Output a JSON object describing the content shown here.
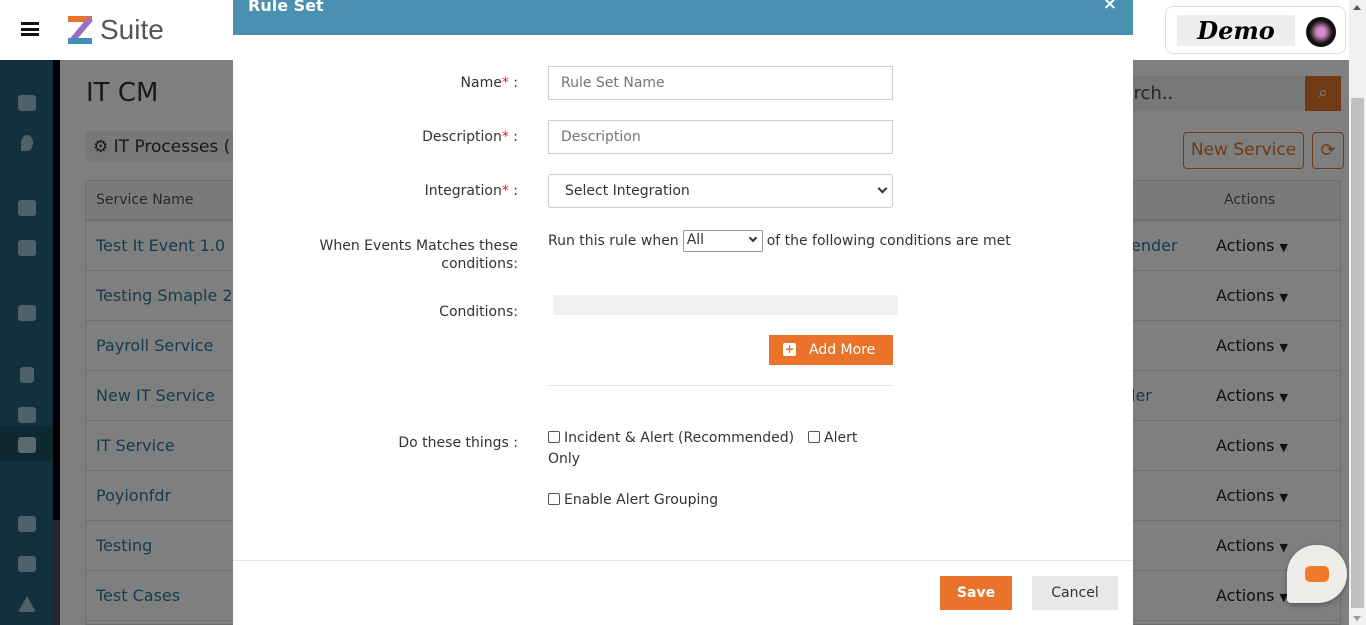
{
  "app": {
    "brand": "Suite",
    "profile_logo": "Demo"
  },
  "sidebar": {
    "icons": [
      "dashboard-icon",
      "location-icon",
      "user-tag-icon",
      "users-gear-icon",
      "calendar-icon",
      "contact-book-icon",
      "hand-dollar-icon",
      "sitemap-icon",
      "envelope-icon",
      "megaphone-icon",
      "warning-icon"
    ],
    "selected": "sitemap-icon"
  },
  "page": {
    "title": "IT CM",
    "section": "IT Processes (",
    "search_placeholder": "Search..",
    "search_visible": "rch..",
    "new_service": "New Service"
  },
  "table": {
    "headers": {
      "name": "Service Name",
      "actions": "Actions"
    },
    "rows": [
      {
        "name": "Test It Event 1.0",
        "extra": "ender",
        "action": "Actions"
      },
      {
        "name": "Testing Smaple 2",
        "extra": "",
        "action": "Actions"
      },
      {
        "name": "Payroll Service",
        "extra": "",
        "action": "Actions"
      },
      {
        "name": "New IT Service",
        "extra": "ler",
        "action": "Actions"
      },
      {
        "name": "IT Service",
        "extra": "",
        "action": "Actions"
      },
      {
        "name": "Poyionfdr",
        "extra": "",
        "action": "Actions"
      },
      {
        "name": "Testing",
        "extra": "",
        "action": "Actions"
      },
      {
        "name": "Test Cases",
        "extra": "",
        "action": "Actions"
      }
    ]
  },
  "modal": {
    "title": "Rule Set",
    "close": "×",
    "name_label": "Name",
    "name_placeholder": "Rule Set Name",
    "desc_label": "Description",
    "desc_placeholder": "Description",
    "integration_label": "Integration",
    "integration_value": "Select Integration",
    "when_label": "When Events Matches these conditions:",
    "run_prefix": "Run this rule when",
    "run_value": "All",
    "run_suffix": "of the following conditions are met",
    "conditions_label": "Conditions:",
    "add_more": "Add More",
    "do_label": "Do these things :",
    "opt_incident": "Incident & Alert (Recommended)",
    "opt_alert": "Alert",
    "opt_alert_cont": "Only",
    "opt_grouping": "Enable Alert Grouping",
    "required": "*",
    "colon": " :",
    "save": "Save",
    "cancel": "Cancel"
  },
  "colors": {
    "modal_header": "#4a90b0",
    "accent": "#e9732a",
    "sidebar": "#26637a"
  }
}
